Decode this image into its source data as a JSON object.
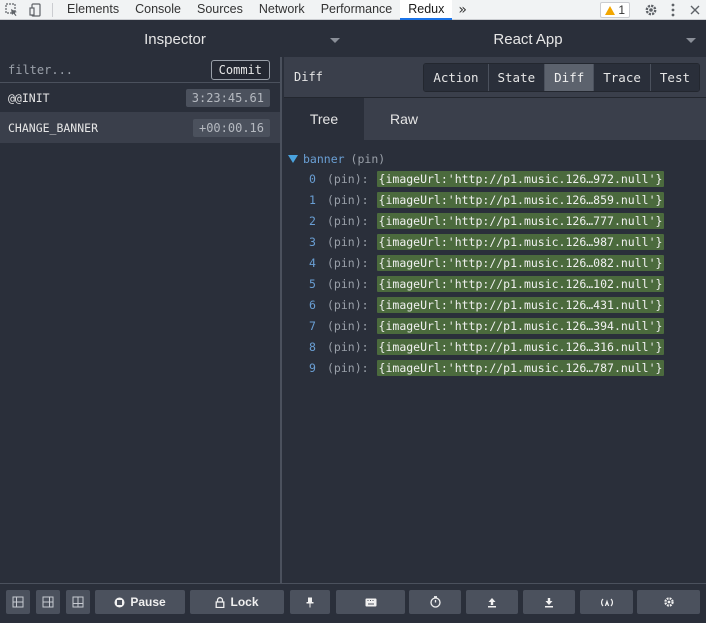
{
  "devtools": {
    "tabs": [
      "Elements",
      "Console",
      "Sources",
      "Network",
      "Performance",
      "Redux"
    ],
    "active_tab": "Redux",
    "more": "»",
    "warning_count": "1"
  },
  "header": {
    "monitor": "Inspector",
    "app": "React App"
  },
  "left": {
    "filter_placeholder": "filter...",
    "commit_label": "Commit",
    "actions": [
      {
        "name": "@@INIT",
        "time": "3:23:45.61"
      },
      {
        "name": "CHANGE_BANNER",
        "time": "+00:00.16"
      }
    ]
  },
  "right": {
    "diff_title": "Diff",
    "modes": [
      "Action",
      "State",
      "Diff",
      "Trace",
      "Test"
    ],
    "active_mode": "Diff",
    "view_tabs": [
      "Tree",
      "Raw"
    ],
    "active_view": "Tree",
    "tree": {
      "root_key": "banner",
      "root_note": "(pin)",
      "items": [
        {
          "index": "0",
          "note": "(pin):",
          "value": "{imageUrl:'http://p1.music.126…972.null'}"
        },
        {
          "index": "1",
          "note": "(pin):",
          "value": "{imageUrl:'http://p1.music.126…859.null'}"
        },
        {
          "index": "2",
          "note": "(pin):",
          "value": "{imageUrl:'http://p1.music.126…777.null'}"
        },
        {
          "index": "3",
          "note": "(pin):",
          "value": "{imageUrl:'http://p1.music.126…987.null'}"
        },
        {
          "index": "4",
          "note": "(pin):",
          "value": "{imageUrl:'http://p1.music.126…082.null'}"
        },
        {
          "index": "5",
          "note": "(pin):",
          "value": "{imageUrl:'http://p1.music.126…102.null'}"
        },
        {
          "index": "6",
          "note": "(pin):",
          "value": "{imageUrl:'http://p1.music.126…431.null'}"
        },
        {
          "index": "7",
          "note": "(pin):",
          "value": "{imageUrl:'http://p1.music.126…394.null'}"
        },
        {
          "index": "8",
          "note": "(pin):",
          "value": "{imageUrl:'http://p1.music.126…316.null'}"
        },
        {
          "index": "9",
          "note": "(pin):",
          "value": "{imageUrl:'http://p1.music.126…787.null'}"
        }
      ]
    }
  },
  "bottom": {
    "pause_label": "Pause",
    "lock_label": "Lock"
  },
  "colors": {
    "background": "#2a2f3a",
    "panel_header": "#3a3f4b",
    "added_value": "#4b6a3d",
    "tree_key": "#6a9fd4",
    "active_tab_underline": "#1a73e8",
    "warning": "#f2a600"
  }
}
